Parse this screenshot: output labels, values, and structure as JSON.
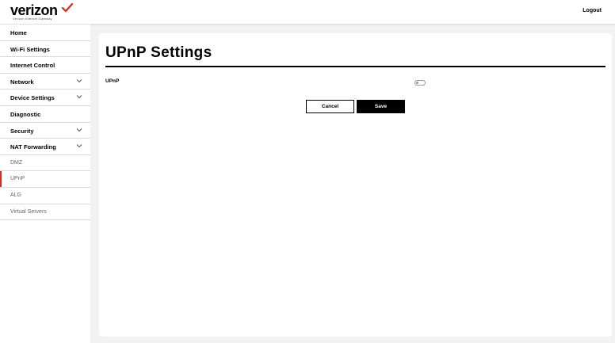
{
  "header": {
    "brand": "verizon",
    "brand_subtitle": "Verizon Internet Gateway",
    "brand_accent": "#d52b1e",
    "logout_label": "Logout"
  },
  "sidebar": {
    "items": [
      {
        "label": "Home"
      },
      {
        "label": "Wi-Fi Settings"
      },
      {
        "label": "Internet Control"
      },
      {
        "label": "Network",
        "expandable": true,
        "icon": "chevron-down-icon"
      },
      {
        "label": "Device Settings",
        "expandable": true,
        "icon": "chevron-down-icon"
      },
      {
        "label": "Diagnostic"
      },
      {
        "label": "Security",
        "expandable": true,
        "icon": "chevron-down-icon"
      },
      {
        "label": "NAT Forwarding",
        "expandable": true,
        "icon": "chevron-down-icon"
      },
      {
        "label": "DMZ",
        "sub": true
      },
      {
        "label": "UPnP",
        "sub": true,
        "active": true
      },
      {
        "label": "ALG",
        "sub": true
      },
      {
        "label": "Virtual Servers",
        "sub": true
      }
    ]
  },
  "main": {
    "title": "UPnP Settings",
    "upnp": {
      "label": "UPnP",
      "enabled": false
    },
    "cancel_label": "Cancel",
    "save_label": "Save"
  }
}
